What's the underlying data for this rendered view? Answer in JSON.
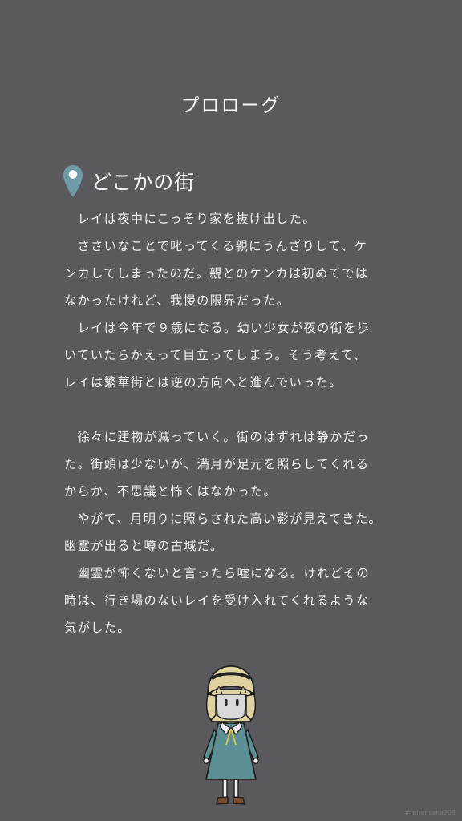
{
  "screen": {
    "title": "プロローグ",
    "location": {
      "icon": "map-pin-icon",
      "label": "どこかの街"
    },
    "story_lines": [
      "　レイは夜中にこっそり家を抜け出した。",
      "　ささいなことで叱ってくる親にうんざりして、ケ",
      "ンカしてしまったのだ。親とのケンカは初めてでは",
      "なかったけれど、我慢の限界だった。",
      "　レイは今年で９歳になる。幼い少女が夜の街を歩",
      "いていたらかえって目立ってしまう。そう考えて、",
      "レイは繁華街とは逆の方向へと進んでいった。",
      "",
      "　徐々に建物が減っていく。街のはずれは静かだっ",
      "た。街頭は少ないが、満月が足元を照らしてくれる",
      "からか、不思議と怖くはなかった。",
      "　やがて、月明りに照らされた高い影が見えてきた。",
      "幽霊が出ると噂の古城だ。",
      "　幽霊が怖くないと言ったら嘘になる。けれどその",
      "時は、行き場のないレイを受け入れてくれるような",
      "気がした。"
    ],
    "character": {
      "name": "girl-character-illustration",
      "colors": {
        "hair": "#dfd2a1",
        "dress": "#5c8f93",
        "shoes": "#7b4a2a",
        "pin": "#6f9aa8"
      }
    },
    "watermark": "#rehensaka208"
  }
}
